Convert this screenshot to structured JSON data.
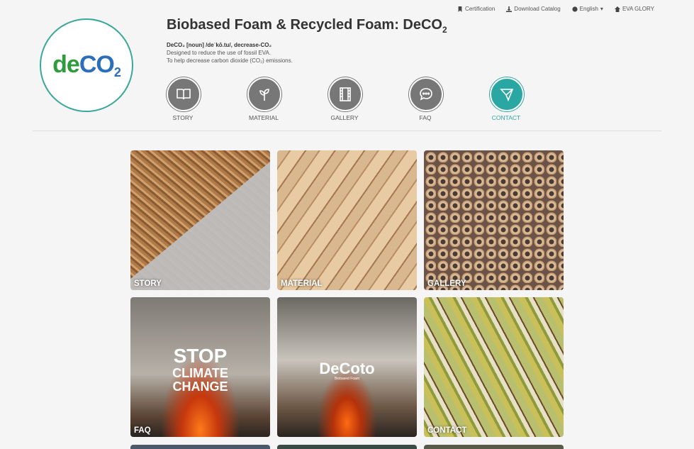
{
  "topbar": {
    "certification": "Certification",
    "download": "Download Catalog",
    "language": "English",
    "brand": "EVA GLORY"
  },
  "logo": {
    "de": "de",
    "co": "CO",
    "two": "2"
  },
  "header": {
    "title_main": "Biobased Foam & Recycled Foam: DeCO",
    "title_sub": "2",
    "def_line": "DeCO₂ [noun] /deˈkō.tu/, decrease-CO₂",
    "line2": "Designed to reduce the use of fossil EVA.",
    "line3": "To help decrease carbon dioxide (CO₂) emissions."
  },
  "nav": [
    {
      "label": "STORY",
      "icon": "book-icon"
    },
    {
      "label": "MATERIAL",
      "icon": "leaf-icon"
    },
    {
      "label": "GALLERY",
      "icon": "film-icon"
    },
    {
      "label": "FAQ",
      "icon": "chat-icon"
    },
    {
      "label": "CONTACT",
      "icon": "send-icon",
      "active": true
    }
  ],
  "tiles": [
    {
      "label": "STORY"
    },
    {
      "label": "MATERIAL"
    },
    {
      "label": "GALLERY"
    },
    {
      "label": "FAQ",
      "headline1": "STOP",
      "headline2": "CLIMATE",
      "headline3": "CHANGE"
    },
    {
      "label": "",
      "brand": "DeCoto",
      "brand_sub": "Biobased Foam"
    },
    {
      "label": "CONTACT"
    }
  ],
  "colors": {
    "accent": "#2aa6a3",
    "icon_bg": "#777777",
    "logo_green": "#2e9c3b",
    "logo_blue": "#2b6fb8"
  }
}
